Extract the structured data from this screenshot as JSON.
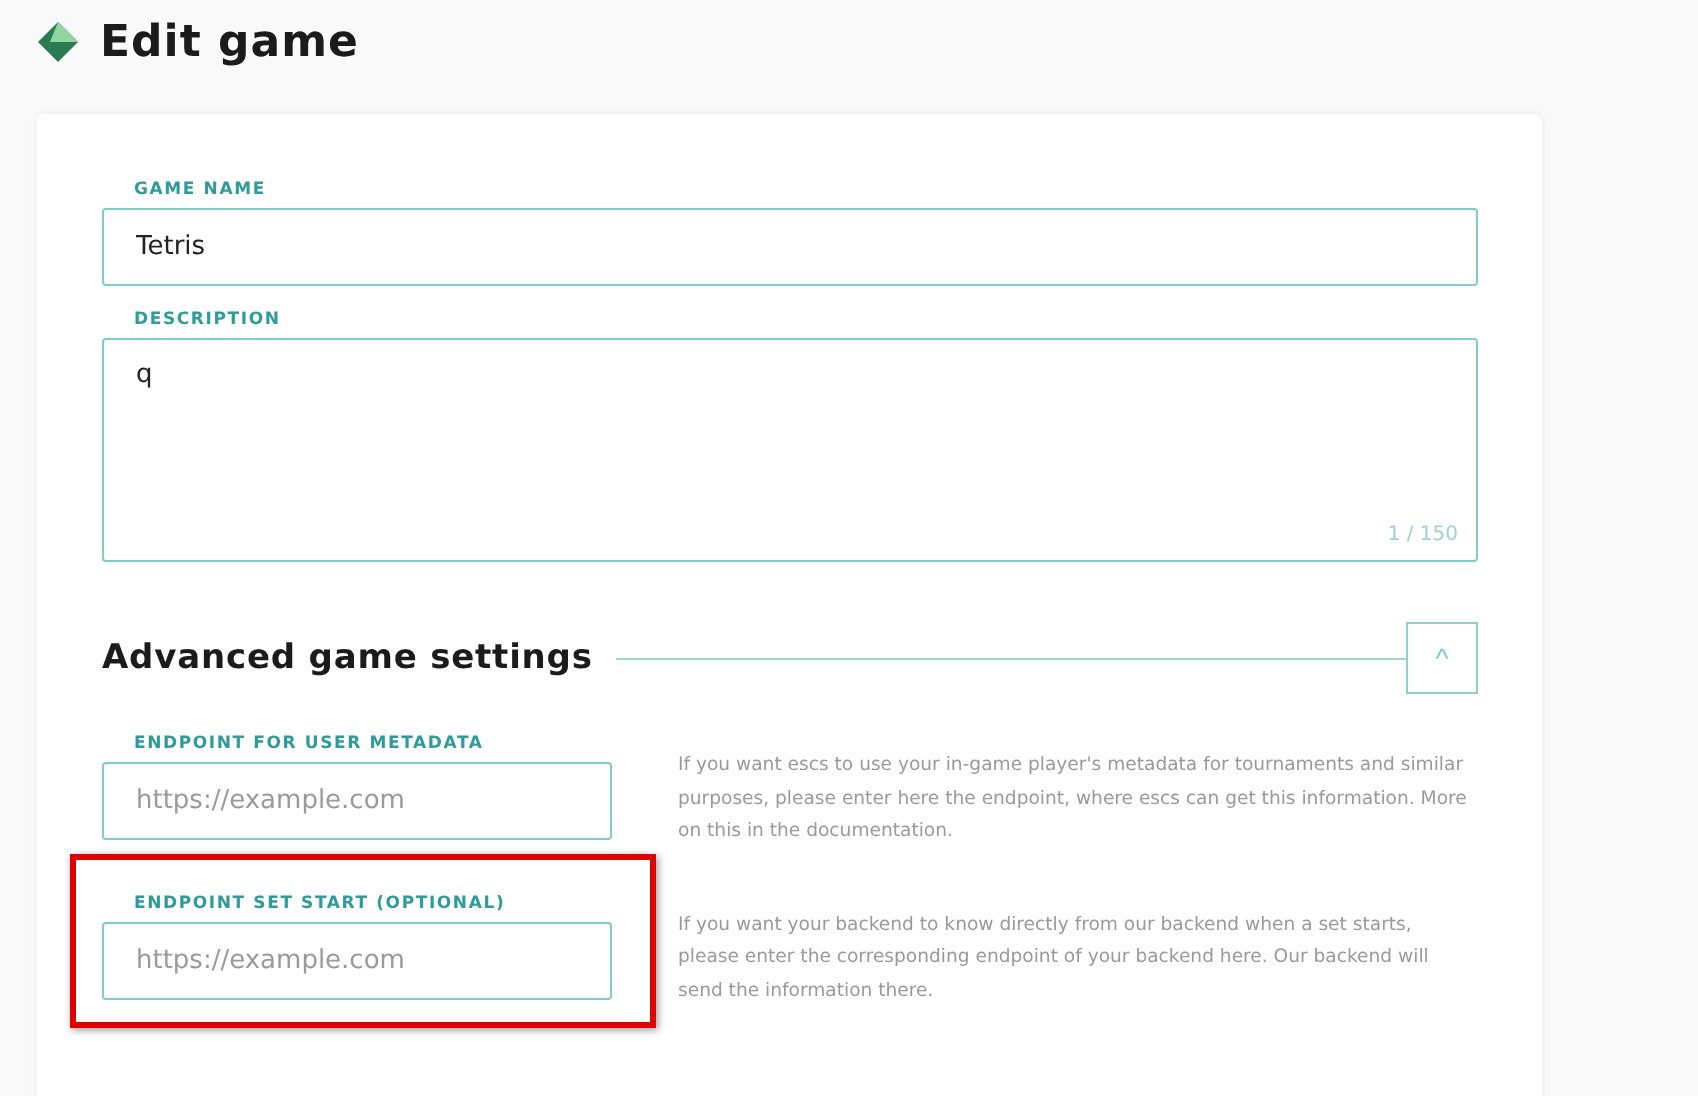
{
  "page": {
    "title": "Edit game"
  },
  "fields": [
    {
      "label": "GAME NAME",
      "value": "Tetris",
      "kind": "input"
    },
    {
      "label": "DESCRIPTION",
      "value": "q",
      "kind": "textarea",
      "counter": "1 / 150"
    }
  ],
  "advanced": {
    "title": "Advanced game settings",
    "expanded": true,
    "toggle": "^",
    "endpoints": [
      {
        "label": "ENDPOINT FOR USER METADATA",
        "placeholder": "https://example.com",
        "help": "If you want escs to use your in-game player's metadata for tournaments and similar purposes, please enter here the endpoint, where escs can get this information. More on this in the documentation.",
        "highlighted": false
      },
      {
        "label": "ENDPOINT SET START (OPTIONAL)",
        "placeholder": "https://example.com",
        "help": "If you want your backend to know directly from our backend when a set starts, please enter the corresponding endpoint of your backend here. Our backend will send the information there.",
        "highlighted": true
      }
    ]
  }
}
